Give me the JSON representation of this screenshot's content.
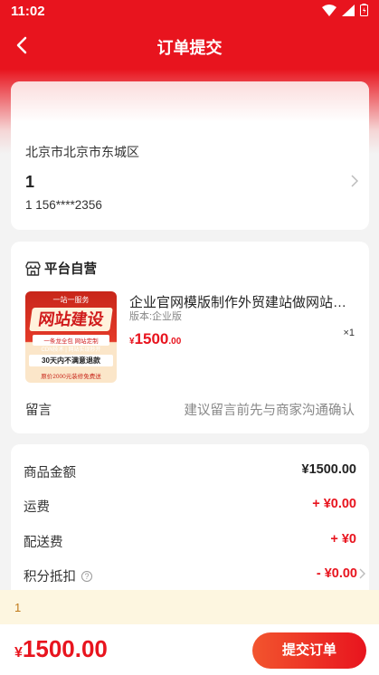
{
  "status_bar": {
    "time": "11:02"
  },
  "header": {
    "title": "订单提交"
  },
  "address": {
    "region": "北京市北京市东城区",
    "name": "1",
    "contact": "1  156****2356"
  },
  "shop": {
    "name": "平台自营",
    "product": {
      "title": "企业官网模版制作外贸建站做网站设计定制开发",
      "spec": "版本:企业版",
      "currency": "¥",
      "price_int": "1500",
      "price_dec": ".00",
      "qty": "×1",
      "image_text": {
        "top": "一站一服务",
        "title": "网站建设",
        "sub": "一条龙全包 网站定制",
        "cdn": "CDN技术 | 网站实现秒开",
        "ribbon": "30天内不满意退款",
        "bottom": "原价2000元装修免费送"
      }
    },
    "message_label": "留言",
    "message_placeholder": "建议留言前先与商家沟通确认"
  },
  "summary": {
    "goods_label": "商品金额",
    "goods_value": "¥1500.00",
    "shipping_label": "运费",
    "shipping_value": "+ ¥0.00",
    "delivery_label": "配送费",
    "delivery_value": "+ ¥0",
    "points_label": "积分抵扣",
    "points_value": "- ¥0.00"
  },
  "notice": {
    "text": "1"
  },
  "footer": {
    "currency": "¥",
    "total": "1500.00",
    "submit_label": "提交订单"
  },
  "colors": {
    "brand": "#e8141e",
    "notice_bg": "#fdf6e0"
  }
}
